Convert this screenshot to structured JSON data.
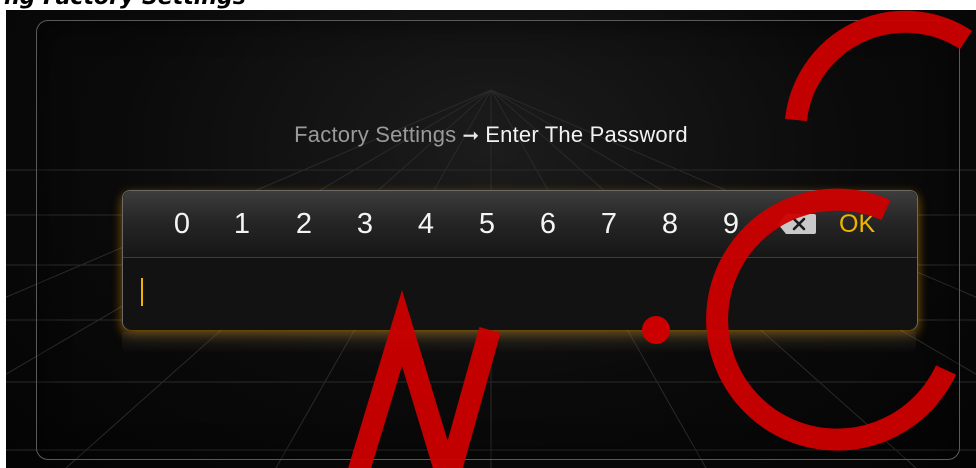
{
  "page": {
    "caption": "ng Factory Settings"
  },
  "header": {
    "breadcrumb_parent": "Factory Settings",
    "arrow_icon": "right-arrow-icon",
    "breadcrumb_current": "Enter The Password"
  },
  "keypad": {
    "digits": [
      "0",
      "1",
      "2",
      "3",
      "4",
      "5",
      "6",
      "7",
      "8",
      "9"
    ],
    "backspace_icon": "backspace-icon",
    "ok_label": "OK"
  },
  "password_field": {
    "value": ""
  },
  "colors": {
    "accent": "#f0b400",
    "title_muted": "#9a9a9a",
    "title_bright": "#f2f2f2"
  },
  "watermark": {
    "text": "W.CC",
    "color": "#cc0000"
  }
}
